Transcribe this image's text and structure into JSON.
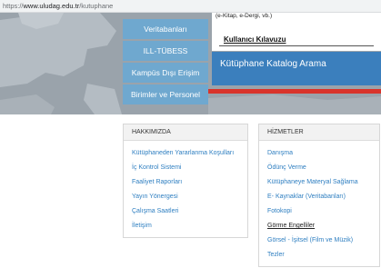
{
  "browser": {
    "url_scheme": "https://",
    "url_host": "www.uludag.edu.tr",
    "url_path": "/kutuphane"
  },
  "hero": {
    "nav_buttons": [
      {
        "label": "Veritabanları"
      },
      {
        "label": "ILL-TÜBESS"
      },
      {
        "label": "Kampüs Dışı Erişim"
      },
      {
        "label": "Birimler ve Personel"
      }
    ],
    "panel_small_text": "(e-Kitap, e-Dergi, vb.)",
    "user_guide_link": "Kullanıcı Kılavuzu",
    "catalog_search_label": "Kütüphane Katalog Arama",
    "accent_blue": "#3b7fbd",
    "accent_red": "#d9342b"
  },
  "about": {
    "title": "HAKKIMIZDA",
    "links": [
      "Kütüphaneden Yararlanma Koşulları",
      "İç Kontrol Sistemi",
      "Faaliyet Raporları",
      "Yayın Yönergesi",
      "Çalışma Saatleri",
      "İletişim"
    ]
  },
  "services": {
    "title": "HİZMETLER",
    "links": [
      "Danışma",
      "Ödünç Verme",
      "Kütüphaneye Materyal Sağlama",
      "E- Kaynaklar (Veritabanları)",
      "Fotokopi",
      "Görme Engelliler",
      "Görsel - İşitsel (Film ve Müzik)",
      "Tezler"
    ]
  }
}
